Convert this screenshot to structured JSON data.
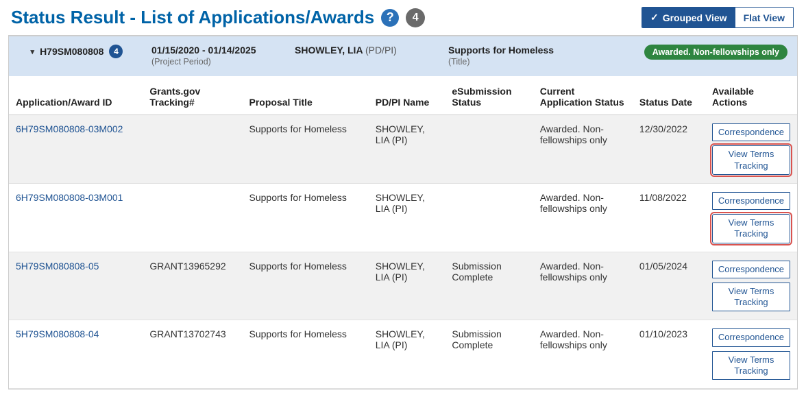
{
  "header": {
    "title": "Status Result - List of Applications/Awards",
    "count_badge": "4",
    "grouped_label": "Grouped View",
    "flat_label": "Flat View"
  },
  "group": {
    "id": "H79SM080808",
    "count": "4",
    "period": "01/15/2020 - 01/14/2025",
    "period_sub": "(Project Period)",
    "person": "SHOWLEY, LIA",
    "person_role": "(PD/PI)",
    "title": "Supports for Homeless",
    "title_sub": "(Title)",
    "status_badge": "Awarded. Non-fellowships only"
  },
  "columns": {
    "id": "Application/Award ID",
    "tracking": "Grants.gov Tracking#",
    "proposal": "Proposal Title",
    "pdpi": "PD/PI Name",
    "esub": "eSubmission Status",
    "status": "Current Application Status",
    "date": "Status Date",
    "actions": "Available Actions"
  },
  "rows": [
    {
      "id": "6H79SM080808-03M002",
      "tracking": "",
      "proposal": "Supports for Homeless",
      "pdpi": "SHOWLEY, LIA (PI)",
      "esub": "",
      "status": "Awarded. Non-fellowships only",
      "date": "12/30/2022",
      "actions": {
        "correspondence": "Correspondence",
        "terms": "View Terms Tracking",
        "highlight": true
      }
    },
    {
      "id": "6H79SM080808-03M001",
      "tracking": "",
      "proposal": "Supports for Homeless",
      "pdpi": "SHOWLEY, LIA (PI)",
      "esub": "",
      "status": "Awarded. Non-fellowships only",
      "date": "11/08/2022",
      "actions": {
        "correspondence": "Correspondence",
        "terms": "View Terms Tracking",
        "highlight": true
      }
    },
    {
      "id": "5H79SM080808-05",
      "tracking": "GRANT13965292",
      "proposal": "Supports for Homeless",
      "pdpi": "SHOWLEY, LIA (PI)",
      "esub": "Submission Complete",
      "status": "Awarded. Non-fellowships only",
      "date": "01/05/2024",
      "actions": {
        "correspondence": "Correspondence",
        "terms": "View Terms Tracking",
        "highlight": false
      }
    },
    {
      "id": "5H79SM080808-04",
      "tracking": "GRANT13702743",
      "proposal": "Supports for Homeless",
      "pdpi": "SHOWLEY, LIA (PI)",
      "esub": "Submission Complete",
      "status": "Awarded. Non-fellowships only",
      "date": "01/10/2023",
      "actions": {
        "correspondence": "Correspondence",
        "terms": "View Terms Tracking",
        "highlight": false
      }
    }
  ]
}
